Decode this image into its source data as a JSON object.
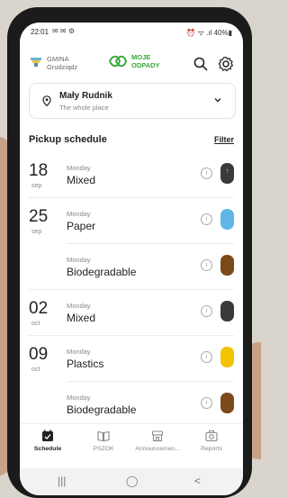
{
  "status_bar": {
    "time": "22:01",
    "left_icons": "✉ ✉ ⚙",
    "right": "⏰ ᯤ .ıl 40%▮"
  },
  "header": {
    "city_line1": "GMINA",
    "city_line2": "Grudziądz",
    "app_line1": "MOJE",
    "app_line2": "ODPADY",
    "icons": [
      "search-icon",
      "gear-icon"
    ]
  },
  "location": {
    "name": "Mały Rudnik",
    "subtitle": "The whole place"
  },
  "schedule": {
    "title": "Pickup schedule",
    "filter_label": "Filter",
    "items": [
      {
        "day": "18",
        "month": "sep",
        "weekday": "Monday",
        "type": "Mixed",
        "color": "#3a3a3a"
      },
      {
        "day": "25",
        "month": "sep",
        "weekday": "Monday",
        "type": "Paper",
        "color": "#5fb7e6"
      },
      {
        "day": "",
        "month": "",
        "weekday": "Monday",
        "type": "Biodegradable",
        "color": "#7a4a1a"
      },
      {
        "day": "02",
        "month": "oct",
        "weekday": "Monday",
        "type": "Mixed",
        "color": "#3a3a3a"
      },
      {
        "day": "09",
        "month": "oct",
        "weekday": "Monday",
        "type": "Plastics",
        "color": "#f4c300"
      },
      {
        "day": "",
        "month": "",
        "weekday": "Monday",
        "type": "Biodegradable",
        "color": "#7a4a1a"
      }
    ]
  },
  "bottom_nav": [
    {
      "label": "Schedule",
      "icon": "calendar-icon",
      "active": true
    },
    {
      "label": "PSZOK",
      "icon": "book-icon",
      "active": false
    },
    {
      "label": "Announcemen...",
      "icon": "store-icon",
      "active": false
    },
    {
      "label": "Reports",
      "icon": "camera-icon",
      "active": false
    }
  ],
  "system_nav": {
    "recent": "|||",
    "home": "◯",
    "back": "<"
  }
}
